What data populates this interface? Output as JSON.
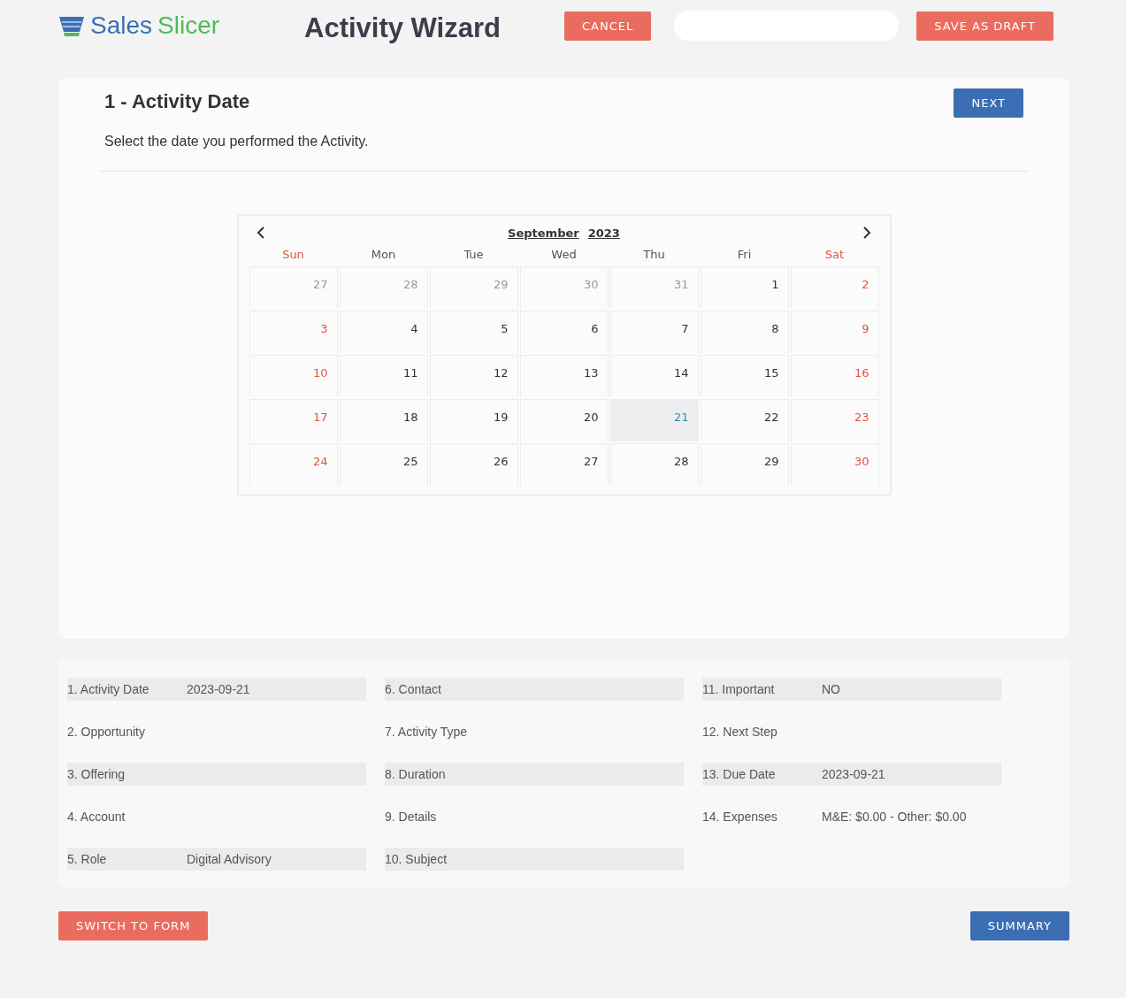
{
  "header": {
    "logo": {
      "word1": "Sales",
      "word2": "Slicer"
    },
    "title": "Activity Wizard",
    "cancel_button": "CANCEL",
    "save_button": "SAVE AS DRAFT"
  },
  "step": {
    "title": "1 - Activity Date",
    "next_button": "NEXT",
    "instruction": "Select the date you performed the Activity."
  },
  "calendar": {
    "month": "September",
    "year": "2023",
    "weekdays": [
      {
        "label": "Sun",
        "kind": "weekend"
      },
      {
        "label": "Mon",
        "kind": "weekday"
      },
      {
        "label": "Tue",
        "kind": "weekday"
      },
      {
        "label": "Wed",
        "kind": "weekday"
      },
      {
        "label": "Thu",
        "kind": "weekday"
      },
      {
        "label": "Fri",
        "kind": "weekday"
      },
      {
        "label": "Sat",
        "kind": "weekend"
      }
    ],
    "days": [
      {
        "label": "27",
        "kind": "other",
        "selected": false
      },
      {
        "label": "28",
        "kind": "other",
        "selected": false
      },
      {
        "label": "29",
        "kind": "other",
        "selected": false
      },
      {
        "label": "30",
        "kind": "other",
        "selected": false
      },
      {
        "label": "31",
        "kind": "other",
        "selected": false
      },
      {
        "label": "1",
        "kind": "weekday",
        "selected": false
      },
      {
        "label": "2",
        "kind": "weekend",
        "selected": false
      },
      {
        "label": "3",
        "kind": "weekend",
        "selected": false
      },
      {
        "label": "4",
        "kind": "weekday",
        "selected": false
      },
      {
        "label": "5",
        "kind": "weekday",
        "selected": false
      },
      {
        "label": "6",
        "kind": "weekday",
        "selected": false
      },
      {
        "label": "7",
        "kind": "weekday",
        "selected": false
      },
      {
        "label": "8",
        "kind": "weekday",
        "selected": false
      },
      {
        "label": "9",
        "kind": "weekend",
        "selected": false
      },
      {
        "label": "10",
        "kind": "weekend",
        "selected": false
      },
      {
        "label": "11",
        "kind": "weekday",
        "selected": false
      },
      {
        "label": "12",
        "kind": "weekday",
        "selected": false
      },
      {
        "label": "13",
        "kind": "weekday",
        "selected": false
      },
      {
        "label": "14",
        "kind": "weekday",
        "selected": false
      },
      {
        "label": "15",
        "kind": "weekday",
        "selected": false
      },
      {
        "label": "16",
        "kind": "weekend",
        "selected": false
      },
      {
        "label": "17",
        "kind": "weekend",
        "selected": false
      },
      {
        "label": "18",
        "kind": "weekday",
        "selected": false
      },
      {
        "label": "19",
        "kind": "weekday",
        "selected": false
      },
      {
        "label": "20",
        "kind": "weekday",
        "selected": false
      },
      {
        "label": "21",
        "kind": "weekday",
        "selected": true
      },
      {
        "label": "22",
        "kind": "weekday",
        "selected": false
      },
      {
        "label": "23",
        "kind": "weekend",
        "selected": false
      },
      {
        "label": "24",
        "kind": "weekend",
        "selected": false
      },
      {
        "label": "25",
        "kind": "weekday",
        "selected": false
      },
      {
        "label": "26",
        "kind": "weekday",
        "selected": false
      },
      {
        "label": "27",
        "kind": "weekday",
        "selected": false
      },
      {
        "label": "28",
        "kind": "weekday",
        "selected": false
      },
      {
        "label": "29",
        "kind": "weekday",
        "selected": false
      },
      {
        "label": "30",
        "kind": "weekend",
        "selected": false
      }
    ]
  },
  "summary": {
    "columns": [
      [
        {
          "label": "1. Activity Date",
          "value": "2023-09-21"
        },
        {
          "label": "2. Opportunity"
        },
        {
          "label": "3. Offering"
        },
        {
          "label": "4. Account"
        },
        {
          "label": "5. Role",
          "value": "Digital Advisory"
        }
      ],
      [
        {
          "label": "6. Contact"
        },
        {
          "label": "7. Activity Type"
        },
        {
          "label": "8. Duration"
        },
        {
          "label": "9. Details"
        },
        {
          "label": "10. Subject"
        }
      ],
      [
        {
          "label": "11. Important",
          "value": "NO"
        },
        {
          "label": "12. Next Step"
        },
        {
          "label": "13. Due Date",
          "value": "2023-09-21"
        },
        {
          "label": "14. Expenses",
          "value": "M&E: $0.00 - Other: $0.00"
        }
      ]
    ]
  },
  "footer": {
    "switch_button": "SWITCH TO FORM",
    "summary_button": "SUMMARY"
  }
}
